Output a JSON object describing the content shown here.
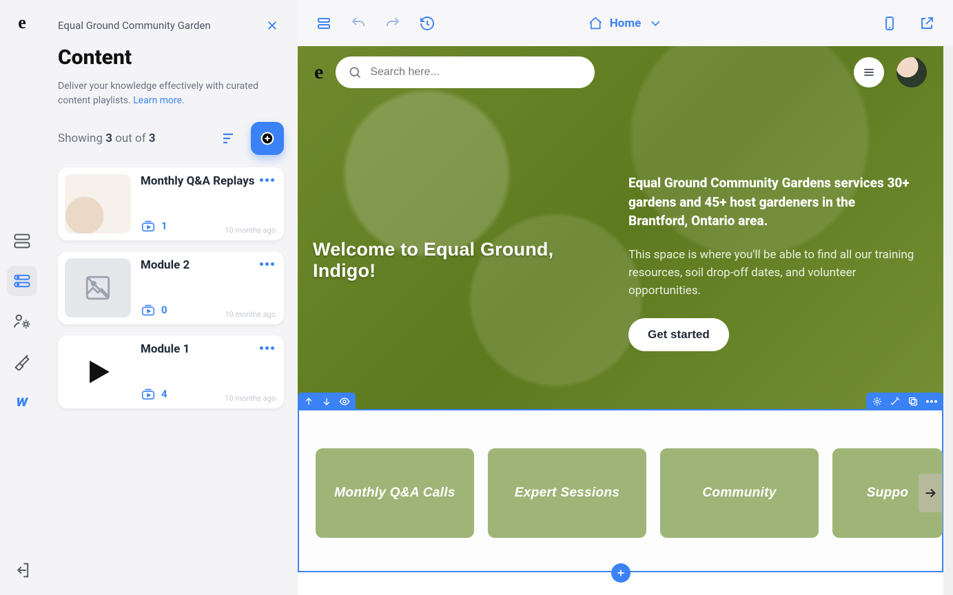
{
  "iconbar": {
    "logo": "e"
  },
  "sidepanel": {
    "project_name": "Equal Ground Community Garden",
    "heading": "Content",
    "description_a": "Deliver your knowledge effectively with curated content playlists. ",
    "description_link": "Learn more.",
    "showing_prefix": "Showing ",
    "showing_a": "3",
    "showing_mid": " out of ",
    "showing_b": "3",
    "cards": [
      {
        "title": "Monthly Q&A Replays",
        "count": "1",
        "time": "10 months ago"
      },
      {
        "title": "Module 2",
        "count": "0",
        "time": "10 months ago"
      },
      {
        "title": "Module 1",
        "count": "4",
        "time": "10 months ago"
      }
    ]
  },
  "topbar": {
    "home_label": "Home"
  },
  "hero": {
    "search_placeholder": "Search here...",
    "welcome": "Welcome to Equal Ground, Indigo!",
    "headline": "Equal Ground Community Gardens services 30+ gardens and 45+ host gardeners in the Brantford, Ontario area.",
    "body": "This space is where you'll be able to find all our training resources, soil drop-off dates, and volunteer opportunities.",
    "cta": "Get started"
  },
  "section": {
    "tiles": [
      {
        "label": "Monthly Q&A Calls"
      },
      {
        "label": "Expert Sessions"
      },
      {
        "label": "Community"
      },
      {
        "label": "Suppo"
      }
    ]
  }
}
